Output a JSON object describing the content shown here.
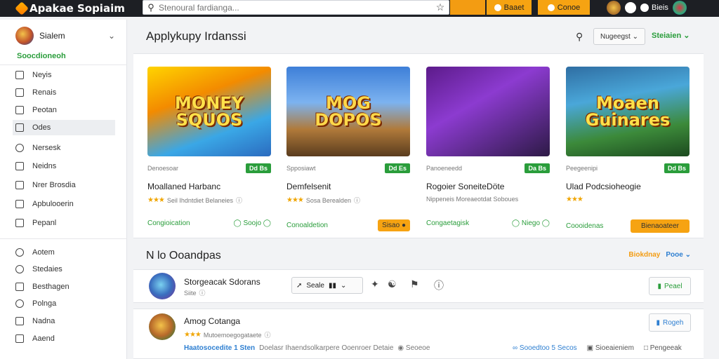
{
  "topbar": {
    "logo": "Apakae Sopiaim",
    "search_placeholder": "Stenoural fardianga...",
    "buttons": [
      "",
      "Baaet",
      "Conoe"
    ],
    "user": "Bieis"
  },
  "sidebar": {
    "user": "Sialem",
    "green_label": "Soocdioneoh",
    "items": [
      {
        "label": "Neyis",
        "icon": "home-icon"
      },
      {
        "label": "Renais",
        "icon": "list-icon"
      },
      {
        "label": "Peotan",
        "icon": "tag-icon"
      },
      {
        "label": "Odes",
        "icon": "card-icon",
        "active": true
      },
      {
        "label": "Nersesk",
        "icon": "game-icon"
      },
      {
        "label": "Neidns",
        "icon": "box-icon"
      },
      {
        "label": "Nrer Brosdia",
        "icon": "edit-icon"
      },
      {
        "label": "Apbulooerin",
        "icon": "check-icon"
      },
      {
        "label": "Pepanl",
        "icon": "page-icon"
      }
    ],
    "items2": [
      {
        "label": "Aotem",
        "icon": "users-icon"
      },
      {
        "label": "Stedaies",
        "icon": "globe-icon"
      },
      {
        "label": "Besthagen",
        "icon": "mail-icon"
      },
      {
        "label": "Polnga",
        "icon": "gear-icon"
      },
      {
        "label": "Nadna",
        "icon": "doc-icon"
      },
      {
        "label": "Aaend",
        "icon": "cart-icon"
      }
    ]
  },
  "main": {
    "title": "Applykupy Irdanssi",
    "select1": "Nugeegst",
    "select2": "Steiaien"
  },
  "cards": [
    {
      "thumb_title": "MONEY SQUOS",
      "meta": "Denoesoar",
      "badge": "Dd Bs",
      "name": "Moallaned Harbanc",
      "stars": "★★★",
      "sub": "Seil Ihdntdiet Belaneies",
      "actions": [
        "Congioication",
        "Soojo"
      ]
    },
    {
      "thumb_title": "MOG DOPOS",
      "meta": "Spposiawt",
      "badge": "Dd Es",
      "name": "Demfelsenit",
      "stars": "★★★",
      "sub": "Sosa Berealden",
      "actions": [
        "Conoaldetion",
        "Sisao"
      ]
    },
    {
      "thumb_title": "",
      "meta": "Panoeneedd",
      "badge": "Da Bs",
      "name": "Rogoier SoneiteDöte",
      "stars": "",
      "sub": "Nippeneis Moreaeotdat Soboues",
      "actions": [
        "Congaetagisk",
        "Niego"
      ]
    },
    {
      "thumb_title": "Moaen Guinares",
      "meta": "Peegeenipi",
      "badge": "Dd Bs",
      "name": "Ulad Podcsioheogie",
      "stars": "★★★",
      "sub": "",
      "actions": [
        "Coooidenas",
        "Bienaoateer"
      ]
    }
  ],
  "section": {
    "title": "N lo Ooandpas",
    "right_orange": "Biokdnay",
    "right_blue": "Pooe"
  },
  "rows": [
    {
      "name": "Storgeacak Sdorans",
      "sub": "Siite",
      "tools_label": "Seale",
      "button": "Peael"
    },
    {
      "name": "Amog Cotanga",
      "stars": "★★★",
      "sub": "Mutoemoegogataete",
      "button": "Rogeh",
      "tag1": "Haatosocedite 1 Sten",
      "tag2": "Doelasr Ihaendsolkarpere Ooenroer Detaie",
      "tag3": "Seoeoe",
      "right": [
        "Sooedtoo 5 Secos",
        "Sioeaieniem",
        "Pengeeak"
      ]
    }
  ]
}
